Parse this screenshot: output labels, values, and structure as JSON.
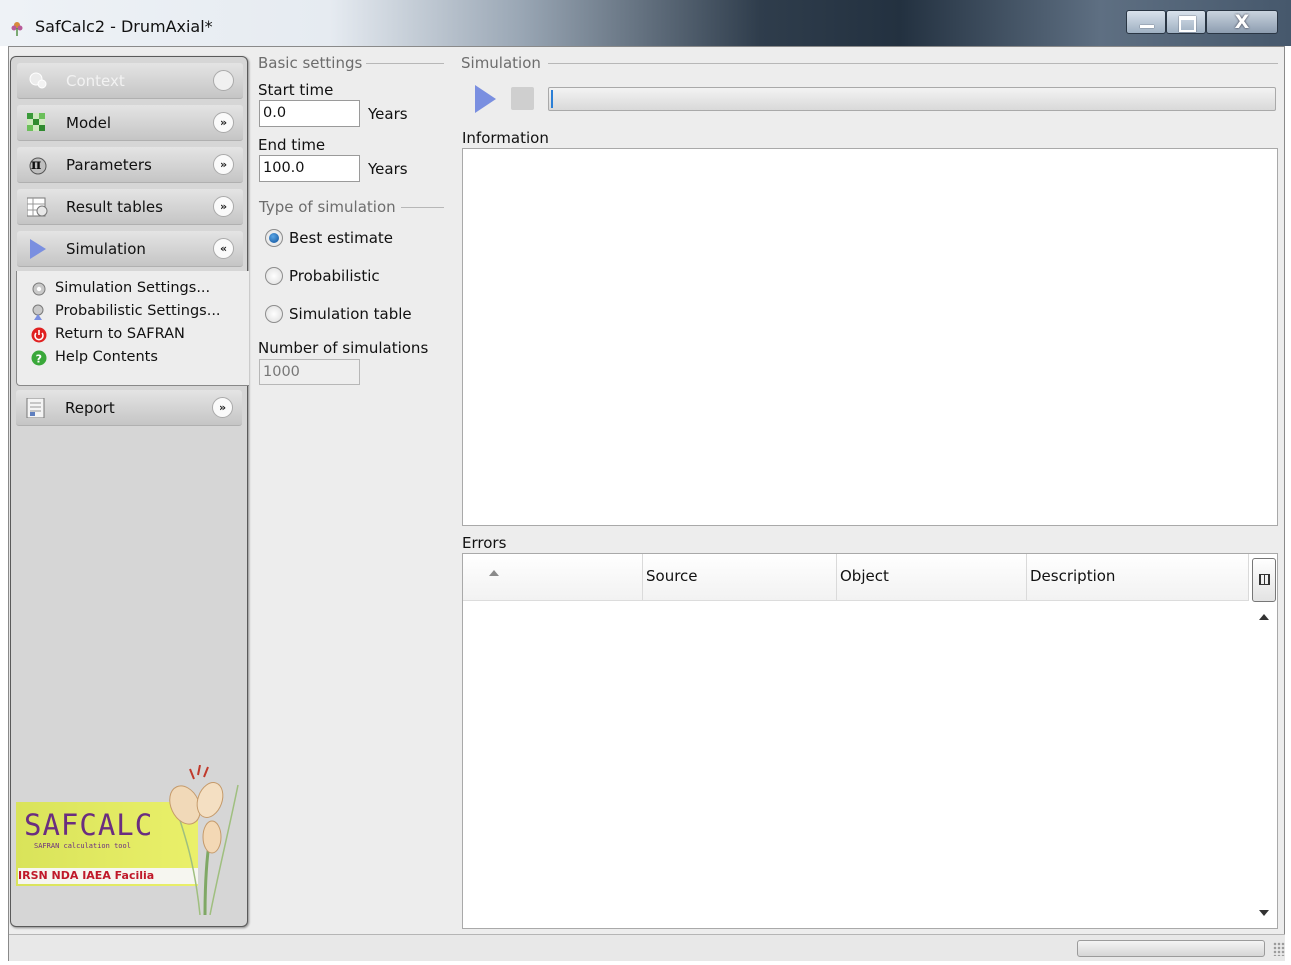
{
  "window": {
    "title": "SafCalc2 - DrumAxial*"
  },
  "sidebar": {
    "nav": [
      {
        "label": "Context",
        "icon": "context-icon",
        "state": "disabled",
        "chevron": "»"
      },
      {
        "label": "Model",
        "icon": "model-icon",
        "chevron": "»"
      },
      {
        "label": "Parameters",
        "icon": "parameters-icon",
        "chevron": "»"
      },
      {
        "label": "Result tables",
        "icon": "result-tables-icon",
        "chevron": "»"
      },
      {
        "label": "Simulation",
        "icon": "simulation-icon",
        "state": "expanded",
        "chevron": "«"
      },
      {
        "label": "Report",
        "icon": "report-icon",
        "chevron": "»"
      }
    ],
    "simulation_items": [
      {
        "label": "Simulation Settings...",
        "icon": "gear-icon"
      },
      {
        "label": "Probabilistic Settings...",
        "icon": "probabilistic-icon"
      },
      {
        "label": "Return to SAFRAN",
        "icon": "power-icon"
      },
      {
        "label": "Help Contents",
        "icon": "help-icon"
      }
    ],
    "logo": {
      "name": "SAFCALC",
      "tagline": "SAFRAN calculation tool",
      "partners": "IRSN NDA IAEA Facilia"
    }
  },
  "basic_settings": {
    "title": "Basic settings",
    "start_time_label": "Start time",
    "start_time": "0.0",
    "end_time_label": "End time",
    "end_time": "100.0",
    "unit": "Years"
  },
  "type_of_simulation": {
    "title": "Type of simulation",
    "options": [
      "Best estimate",
      "Probabilistic",
      "Simulation table"
    ],
    "selected": "Best estimate",
    "number_label": "Number of simulations",
    "number": "1000"
  },
  "simulation": {
    "title": "Simulation",
    "progress": 0,
    "accent": "#2b7fd6"
  },
  "information": {
    "label": "Information"
  },
  "errors": {
    "label": "Errors",
    "columns": [
      "Source",
      "Object",
      "Description"
    ],
    "rows": []
  }
}
